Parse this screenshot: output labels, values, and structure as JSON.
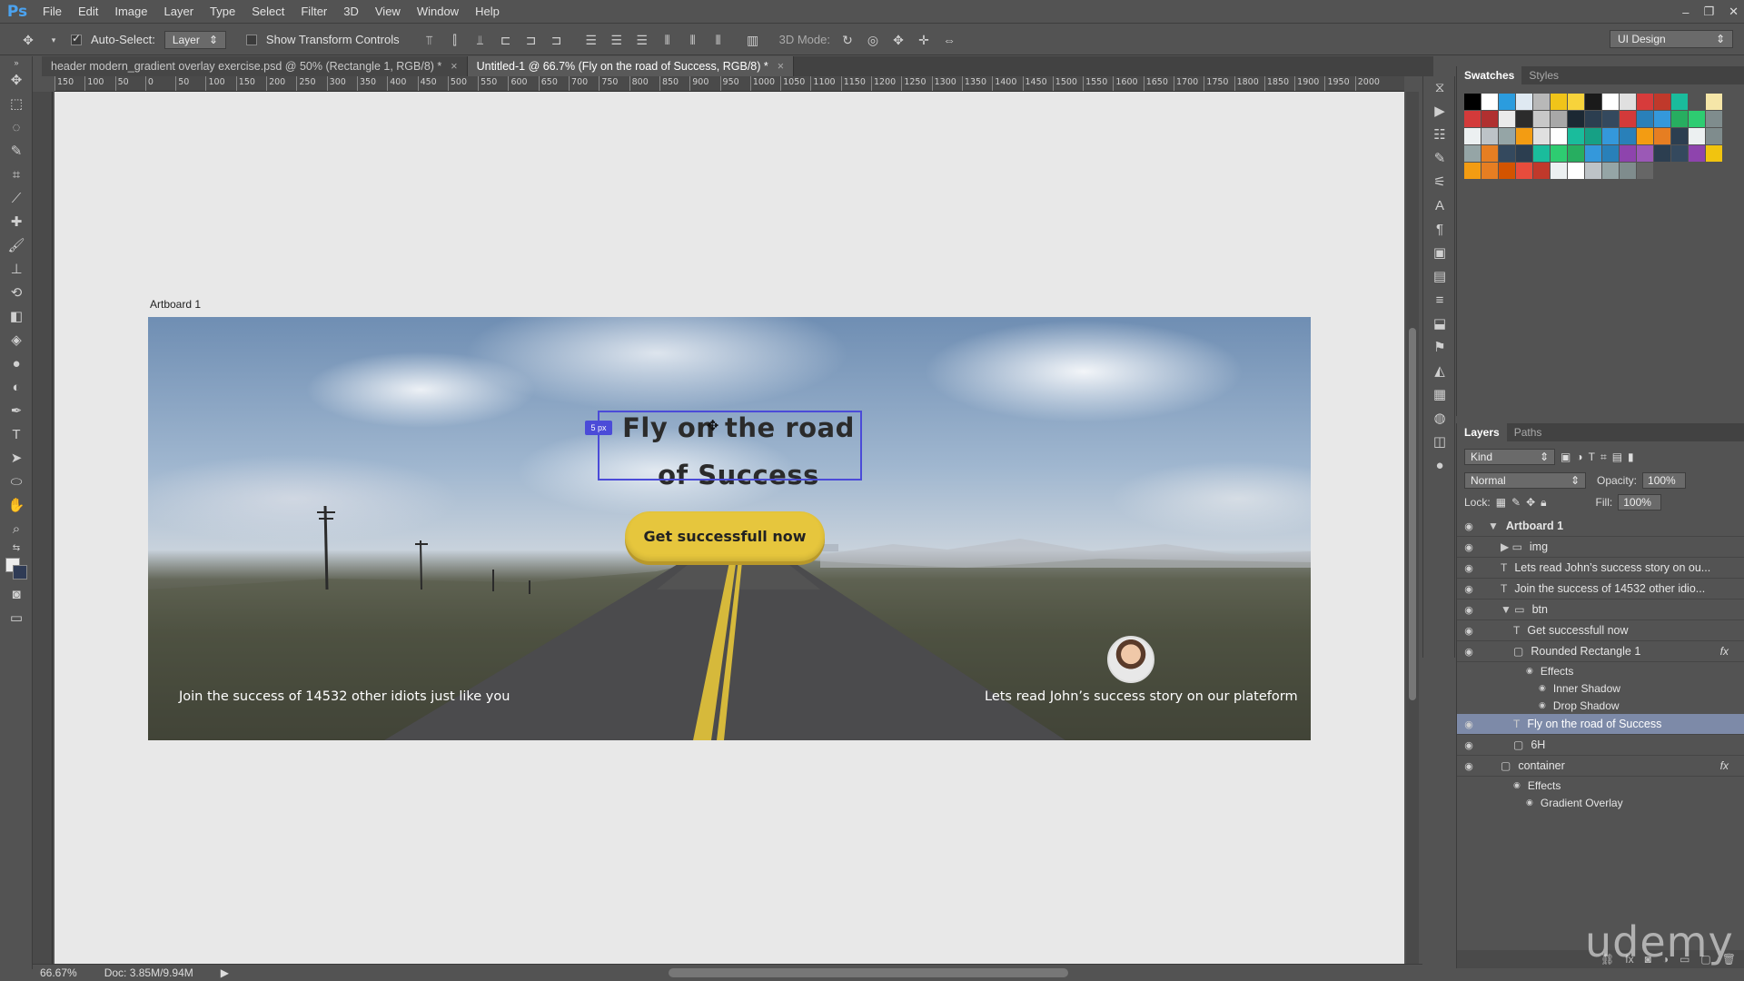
{
  "menu": {
    "logo": "Ps",
    "items": [
      "File",
      "Edit",
      "Image",
      "Layer",
      "Type",
      "Select",
      "Filter",
      "3D",
      "View",
      "Window",
      "Help"
    ],
    "window_controls": [
      "–",
      "❐",
      "✕"
    ]
  },
  "options": {
    "auto_select_label": "Auto-Select:",
    "auto_select_value": "Layer",
    "show_transform_label": "Show Transform Controls",
    "mode_3d_label": "3D Mode:",
    "workspace": "UI Design"
  },
  "tabs": [
    {
      "label": "header modern_gradient overlay exercise.psd @ 50% (Rectangle 1, RGB/8) *",
      "active": false
    },
    {
      "label": "Untitled-1 @ 66.7% (Fly on the road of Success, RGB/8) *",
      "active": true
    }
  ],
  "ruler": {
    "labels": [
      "150",
      "100",
      "50",
      "0",
      "50",
      "100",
      "150",
      "200",
      "250",
      "300",
      "350",
      "400",
      "450",
      "500",
      "550",
      "600",
      "650",
      "700",
      "750",
      "800",
      "850",
      "900",
      "950",
      "1000",
      "1050",
      "1100",
      "1150",
      "1200",
      "1250",
      "1300",
      "1350",
      "1400",
      "1450",
      "1500",
      "1550",
      "1600",
      "1650",
      "1700",
      "1750",
      "1800",
      "1850",
      "1900",
      "1950",
      "2000"
    ]
  },
  "artboard": {
    "label": "Artboard 1",
    "headline": "Fly on the road of Success",
    "selection_badge": "5 px",
    "button_label": "Get successfull now",
    "left_caption": "Join the success of 14532 other idiots just like you",
    "right_caption": "Lets read John’s success story on our plateform"
  },
  "swatches_panel": {
    "tabs": [
      "Swatches",
      "Styles"
    ],
    "rows": [
      [
        "#000000",
        "#ffffff",
        "#2b9cde",
        "#dfe9f2",
        "#b8b8b8",
        "#f0c419",
        "#f7d33b",
        "#1a1a1a",
        "#ffffff",
        "#e0e0e0",
        "#d73b3b",
        "#c0392b",
        "#1abc9c",
        "#535353",
        "#f5e6a8"
      ],
      [
        "#d33a3a",
        "#b03030",
        "#eaeaea",
        "#2c2c2c",
        "#c8c8c8",
        "#a8a8a8",
        "#1c2833",
        "#2c3e50",
        "#34495e",
        "#d33a3a",
        "#2980b9",
        "#3498db",
        "#27ae60",
        "#2ecc71",
        "#7f8c8d"
      ],
      [
        "#ecf0f1",
        "#bdc3c7",
        "#95a5a6",
        "#f39c12",
        "#e0e0e0",
        "#ffffff",
        "#1abc9c",
        "#16a085",
        "#3498db",
        "#2980b9",
        "#f39c12",
        "#e67e22",
        "#2c3e50",
        "#ecf0f1",
        "#7f8c8d"
      ],
      [
        "#95a5a6",
        "#e67e22",
        "#34495e",
        "#2c3e50",
        "#1abc9c",
        "#2ecc71",
        "#27ae60",
        "#3498db",
        "#2980b9",
        "#8e44ad",
        "#9b59b6",
        "#2c3e50",
        "#34495e",
        "#8e44ad",
        "#f1c40f"
      ],
      [
        "#f39c12",
        "#e67e22",
        "#d35400",
        "#e74c3c",
        "#c0392b",
        "#ecf0f1",
        "#ffffff",
        "#bdc3c7",
        "#95a5a6",
        "#7f8c8d",
        "#666666",
        "#535353"
      ]
    ]
  },
  "layers_panel": {
    "tabs": [
      "Layers",
      "Paths"
    ],
    "filter": "Kind",
    "blend_mode": "Normal",
    "opacity_label": "Opacity:",
    "opacity_value": "100%",
    "lock_label": "Lock:",
    "fill_label": "Fill:",
    "fill_value": "100%",
    "layers": [
      {
        "name": "Artboard 1",
        "indent": 0,
        "icon": "▼",
        "type": "artboard",
        "fx": false,
        "selected": false,
        "sub": false
      },
      {
        "name": "img",
        "indent": 1,
        "icon": "▶ ▭",
        "type": "group",
        "fx": false,
        "selected": false,
        "sub": false
      },
      {
        "name": "Lets read John’s success story on ou...",
        "indent": 1,
        "icon": "T",
        "type": "text",
        "fx": false,
        "selected": false,
        "sub": false
      },
      {
        "name": "Join the success of 14532 other idio...",
        "indent": 1,
        "icon": "T",
        "type": "text",
        "fx": false,
        "selected": false,
        "sub": false
      },
      {
        "name": "btn",
        "indent": 1,
        "icon": "▼ ▭",
        "type": "group",
        "fx": false,
        "selected": false,
        "sub": false
      },
      {
        "name": "Get successfull now",
        "indent": 2,
        "icon": "T",
        "type": "text",
        "fx": false,
        "selected": false,
        "sub": false
      },
      {
        "name": "Rounded Rectangle 1",
        "indent": 2,
        "icon": "▢",
        "type": "shape",
        "fx": true,
        "selected": false,
        "sub": false
      },
      {
        "name": "Effects",
        "indent": 3,
        "icon": "◉",
        "type": "effect",
        "fx": false,
        "selected": false,
        "sub": true
      },
      {
        "name": "Inner Shadow",
        "indent": 4,
        "icon": "◉",
        "type": "effect",
        "fx": false,
        "selected": false,
        "sub": true
      },
      {
        "name": "Drop Shadow",
        "indent": 4,
        "icon": "◉",
        "type": "effect",
        "fx": false,
        "selected": false,
        "sub": true
      },
      {
        "name": "Fly on the road of Success",
        "indent": 2,
        "icon": "T",
        "type": "text",
        "fx": false,
        "selected": true,
        "sub": false
      },
      {
        "name": "6H",
        "indent": 2,
        "icon": "▢",
        "type": "shape",
        "fx": false,
        "selected": false,
        "sub": false
      },
      {
        "name": "container",
        "indent": 1,
        "icon": "▢",
        "type": "shape",
        "fx": true,
        "selected": false,
        "sub": false
      },
      {
        "name": "Effects",
        "indent": 2,
        "icon": "◉",
        "type": "effect",
        "fx": false,
        "selected": false,
        "sub": true
      },
      {
        "name": "Gradient Overlay",
        "indent": 3,
        "icon": "◉",
        "type": "effect",
        "fx": false,
        "selected": false,
        "sub": true
      }
    ],
    "fx_label": "fx"
  },
  "status": {
    "zoom": "66.67%",
    "doc": "Doc: 3.85M/9.94M"
  },
  "watermark": "udemy"
}
